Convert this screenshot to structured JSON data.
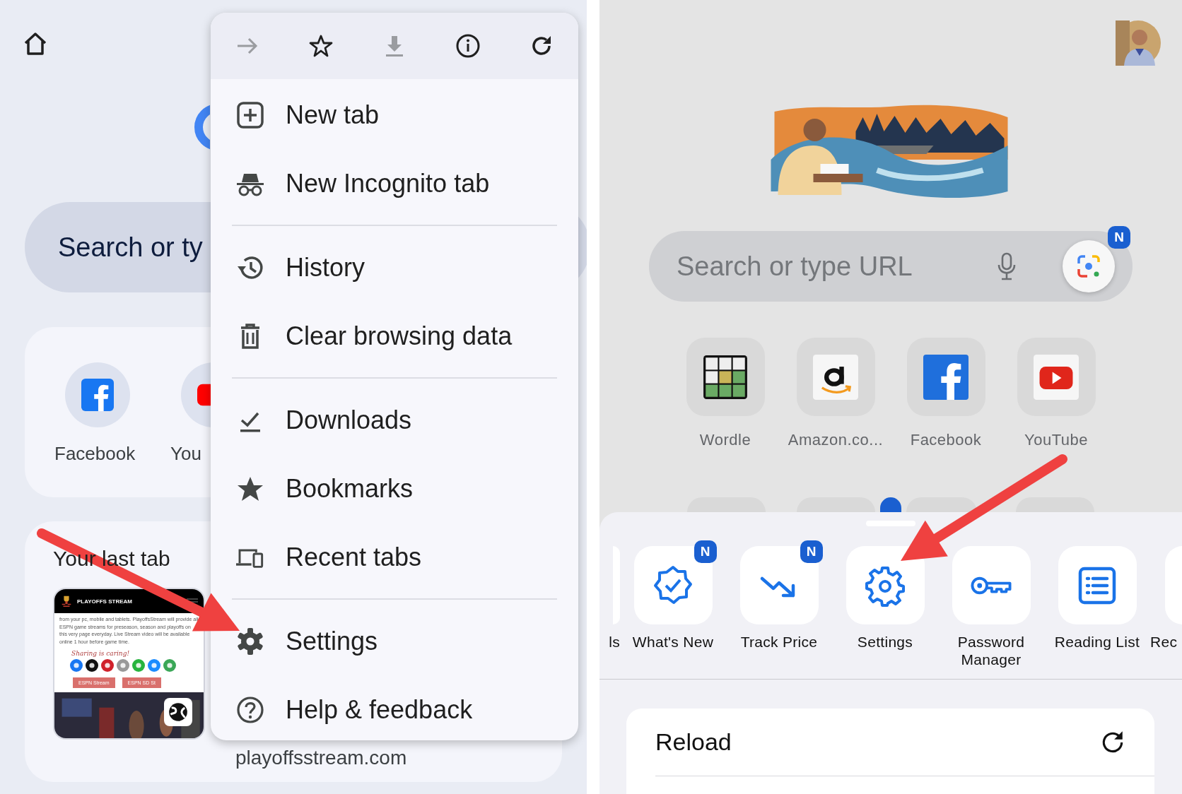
{
  "left_screen": {
    "search": {
      "text": "Search or ty"
    },
    "shortcuts": [
      {
        "kind": "facebook",
        "label": "Facebook"
      },
      {
        "kind": "youtube",
        "label": "You"
      }
    ],
    "last_tab": {
      "title": "Your last tab",
      "url": "playoffsstream.com",
      "page": {
        "site_title": "PLAYOFFS STREAM",
        "body": "from your pc, mobile and tablets. PlayoffsStream will provide all ESPN game streams for preseason, season and playoffs on this very page everyday. Live Stream video will be available online 1 hour before game time.",
        "share_heading": "Sharing is caring!",
        "share_icons": [
          {
            "kind": "facebook"
          },
          {
            "kind": "x"
          },
          {
            "kind": "pinterest"
          },
          {
            "kind": "email"
          },
          {
            "kind": "whatsapp"
          },
          {
            "kind": "messenger"
          },
          {
            "kind": "share"
          }
        ],
        "buttons": [
          "ESPN Stream",
          "ESPN SD St"
        ]
      }
    },
    "menu": {
      "toolbar": [
        {
          "kind": "forward",
          "disabled": true
        },
        {
          "kind": "bookmark",
          "disabled": false
        },
        {
          "kind": "download",
          "disabled": true
        },
        {
          "kind": "info",
          "disabled": false
        },
        {
          "kind": "reload",
          "disabled": false
        }
      ],
      "items": [
        {
          "kind": "new-tab",
          "label": "New tab"
        },
        {
          "kind": "incognito",
          "label": "New Incognito tab"
        },
        {
          "kind": "divider"
        },
        {
          "kind": "history",
          "label": "History"
        },
        {
          "kind": "clear",
          "label": "Clear browsing data"
        },
        {
          "kind": "divider"
        },
        {
          "kind": "downloads",
          "label": "Downloads"
        },
        {
          "kind": "bookmarks",
          "label": "Bookmarks"
        },
        {
          "kind": "recent",
          "label": "Recent tabs"
        },
        {
          "kind": "divider"
        },
        {
          "kind": "settings",
          "label": "Settings"
        },
        {
          "kind": "help",
          "label": "Help & feedback"
        }
      ]
    }
  },
  "right_screen": {
    "search": {
      "placeholder": "Search or type URL",
      "lens_badge": "N"
    },
    "shortcuts": [
      {
        "kind": "wordle",
        "label": "Wordle"
      },
      {
        "kind": "amazon",
        "label": "Amazon.co..."
      },
      {
        "kind": "facebook",
        "label": "Facebook"
      },
      {
        "kind": "youtube",
        "label": "YouTube"
      }
    ],
    "sheet": {
      "actions": [
        {
          "kind": "partial-left",
          "label": "ls"
        },
        {
          "kind": "whats-new",
          "label": "What's New",
          "badge": "N"
        },
        {
          "kind": "track-price",
          "label": "Track Price",
          "badge": "N"
        },
        {
          "kind": "settings",
          "label": "Settings"
        },
        {
          "kind": "password-manager",
          "label": "Password Manager"
        },
        {
          "kind": "reading-list",
          "label": "Reading List"
        },
        {
          "kind": "partial-right",
          "label": "Rec"
        }
      ],
      "rows": [
        {
          "kind": "reload",
          "label": "Reload"
        }
      ]
    }
  }
}
